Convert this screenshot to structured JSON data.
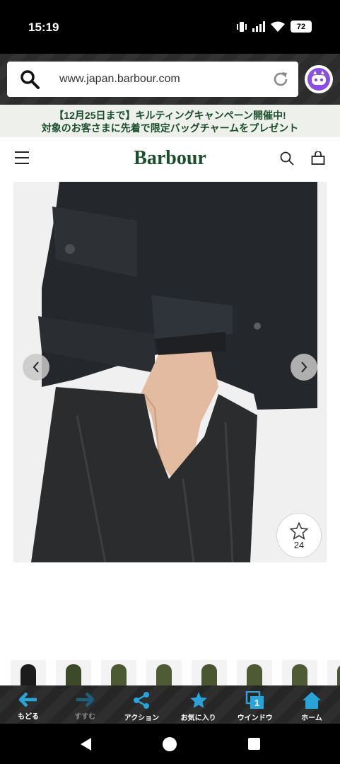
{
  "status": {
    "time": "15:19",
    "battery": "72"
  },
  "browser": {
    "url": "www.japan.barbour.com"
  },
  "promo": {
    "line1": "【12月25日まで】キルティングキャンペーン開催中!",
    "line2": "対象のお客さまに先着で限定バッグチャームをプレゼント"
  },
  "header": {
    "logo": "Barbour"
  },
  "product": {
    "favorite_count": "24"
  },
  "thumbnails": [
    {
      "color": "#1c1c1c"
    },
    {
      "color": "#3c4a2a"
    },
    {
      "color": "#4b5a33"
    },
    {
      "color": "#4e5b35"
    },
    {
      "color": "#4a5632"
    },
    {
      "color": "#4d5a33"
    },
    {
      "color": "#4f5b35"
    },
    {
      "color": "#4a5732"
    }
  ],
  "toolbar": {
    "back": "もどる",
    "forward": "すすむ",
    "action": "アクション",
    "favorites": "お気に入り",
    "window": "ウインドウ",
    "window_count": "1",
    "home": "ホーム"
  },
  "colors": {
    "accent": "#2aa3d8",
    "brand_green": "#1b4e2b"
  }
}
